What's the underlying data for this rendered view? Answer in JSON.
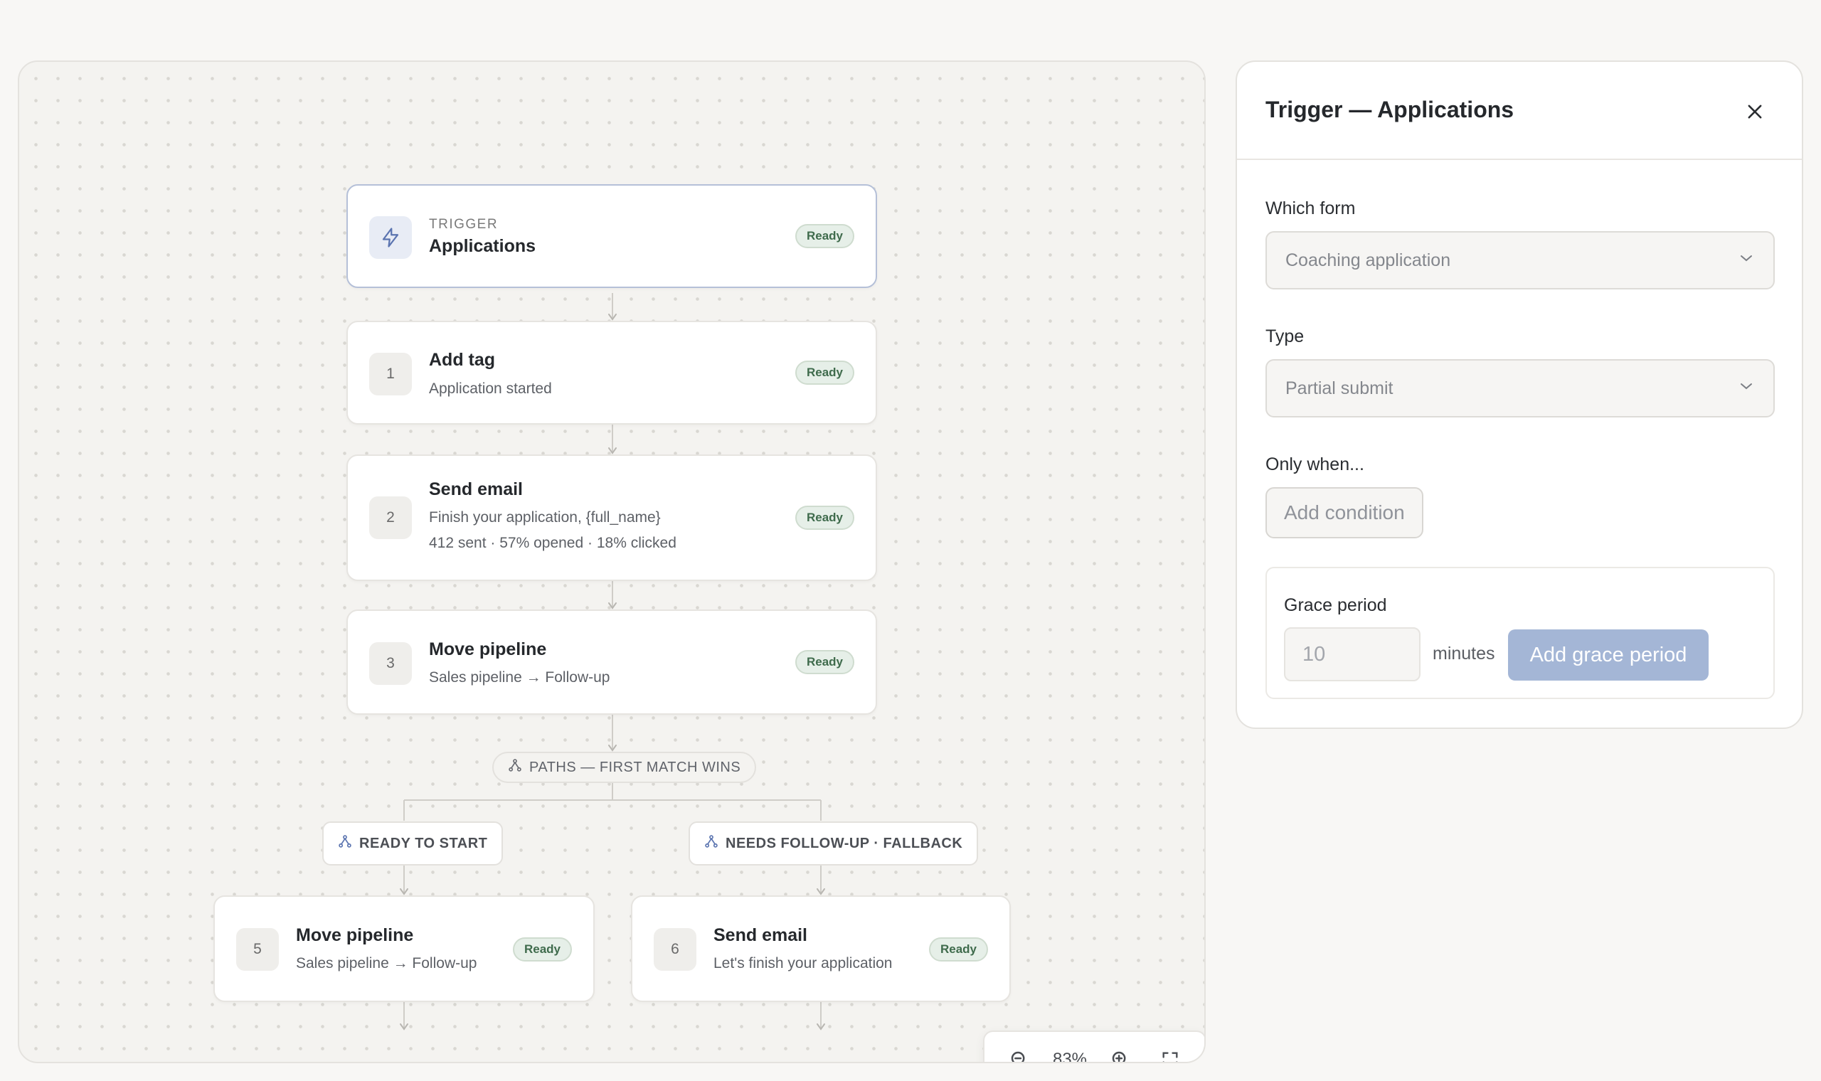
{
  "workflow": {
    "trigger": {
      "kicker": "TRIGGER",
      "title": "Applications",
      "status": "Ready"
    },
    "steps": [
      {
        "num": "1",
        "title": "Add tag",
        "sub": "Application started",
        "status": "Ready"
      },
      {
        "num": "2",
        "title": "Send email",
        "sub": "Finish your application, {full_name}",
        "stats": "412 sent · 57% opened · 18% clicked",
        "status": "Ready"
      },
      {
        "num": "3",
        "title": "Move pipeline",
        "sub": "Sales pipeline → Follow-up",
        "status": "Ready"
      }
    ],
    "paths_label": "PATHS — FIRST MATCH WINS",
    "branches": [
      {
        "label": "READY TO START",
        "step": {
          "num": "5",
          "title": "Move pipeline",
          "sub": "Sales pipeline → Follow-up",
          "status": "Ready"
        }
      },
      {
        "label": "NEEDS FOLLOW-UP · FALLBACK",
        "step": {
          "num": "6",
          "title": "Send email",
          "sub": "Let's finish your application",
          "status": "Ready"
        }
      }
    ]
  },
  "zoom": {
    "level": "83%"
  },
  "panel": {
    "title": "Trigger — Applications",
    "form_label": "Which form",
    "form_value": "Coaching application",
    "type_label": "Type",
    "type_value": "Partial submit",
    "condition_label": "Only when...",
    "add_condition": "Add condition",
    "grace_label": "Grace period",
    "grace_value": "10",
    "grace_unit": "minutes",
    "grace_button": "Add grace period"
  },
  "icons": {
    "trigger": "lightning-icon",
    "branch": "branch-icon",
    "zoom_out": "zoom-out-icon",
    "zoom_in": "zoom-in-icon",
    "fit": "fullscreen-icon",
    "close": "close-icon",
    "chevron": "chevron-down-icon"
  },
  "colors": {
    "ready_badge_bg": "#e6efe8",
    "ready_badge_text": "#3f6b4c",
    "accent_button": "#a4b6d6",
    "trigger_icon": "#5b74b0"
  }
}
